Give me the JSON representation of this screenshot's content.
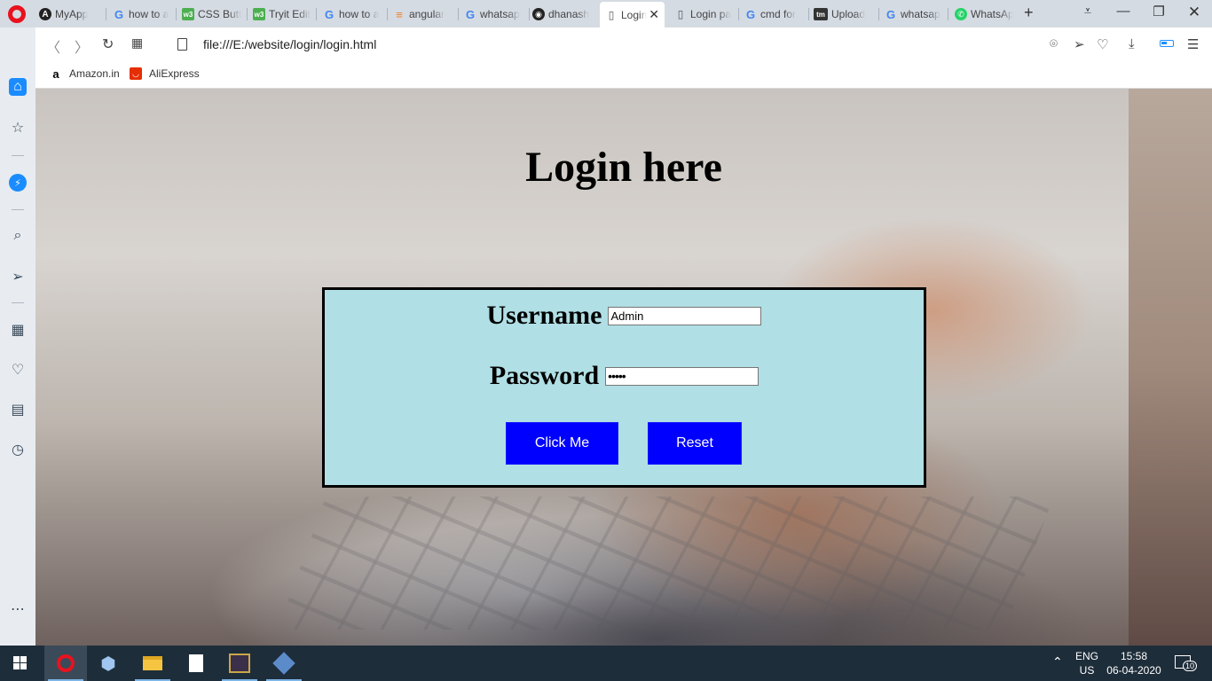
{
  "browser": {
    "tabs": [
      {
        "title": "MyApp",
        "icon": "angular-icon",
        "color": "#222222"
      },
      {
        "title": "how to a",
        "icon": "google-icon",
        "color": "#4285f4"
      },
      {
        "title": "CSS Butt",
        "icon": "w3schools-icon",
        "color": "#4caf50"
      },
      {
        "title": "Tryit Edit",
        "icon": "w3schools-icon",
        "color": "#4caf50"
      },
      {
        "title": "how to a",
        "icon": "google-icon",
        "color": "#4285f4"
      },
      {
        "title": "angular",
        "icon": "stackoverflow-icon",
        "color": "#f48024"
      },
      {
        "title": "whatsap",
        "icon": "google-icon",
        "color": "#4285f4"
      },
      {
        "title": "dhanash",
        "icon": "github-icon",
        "color": "#222222"
      },
      {
        "title": "Login",
        "icon": "page-icon",
        "color": "#555555",
        "active": true
      },
      {
        "title": "Login pa",
        "icon": "page-icon",
        "color": "#555555"
      },
      {
        "title": "cmd for",
        "icon": "google-icon",
        "color": "#4285f4"
      },
      {
        "title": "Upload",
        "icon": "tinypic-icon",
        "color": "#333333"
      },
      {
        "title": "whatsap",
        "icon": "google-icon",
        "color": "#4285f4"
      },
      {
        "title": "WhatsAp",
        "icon": "whatsapp-icon",
        "color": "#25d366"
      }
    ],
    "url": "file:///E:/website/login/login.html",
    "bookmarks": [
      {
        "label": "Amazon.in",
        "icon": "amazon-icon"
      },
      {
        "label": "AliExpress",
        "icon": "aliexpress-icon"
      }
    ]
  },
  "page": {
    "heading": "Login here",
    "username_label": "Username",
    "username_value": "Admin",
    "password_label": "Password",
    "password_value": "•••••",
    "submit_label": "Click Me",
    "reset_label": "Reset",
    "accent_color": "#0000ff",
    "box_color": "#b0dfe5"
  },
  "taskbar": {
    "language": "ENG",
    "region": "US",
    "time": "15:58",
    "date": "06-04-2020",
    "notification_count": "10"
  }
}
